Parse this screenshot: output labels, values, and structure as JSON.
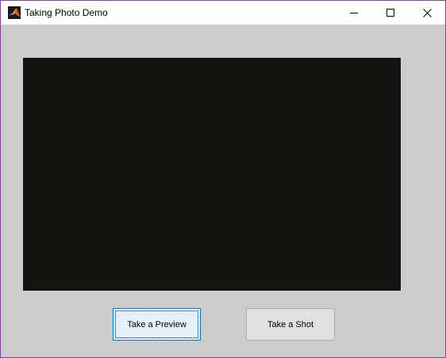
{
  "window": {
    "title": "Taking Photo Demo",
    "app_icon": "matlab-icon",
    "controls": {
      "minimize_icon": "minimize-icon",
      "maximize_icon": "maximize-icon",
      "close_icon": "close-icon"
    }
  },
  "preview": {
    "background_color": "#131412"
  },
  "buttons": {
    "preview_label": "Take a Preview",
    "shot_label": "Take a Shot"
  },
  "colors": {
    "client_background": "#cccccc",
    "window_border": "#8a3fa0",
    "focused_button_border": "#0078d7",
    "focused_button_fill": "#e5f1fb"
  }
}
